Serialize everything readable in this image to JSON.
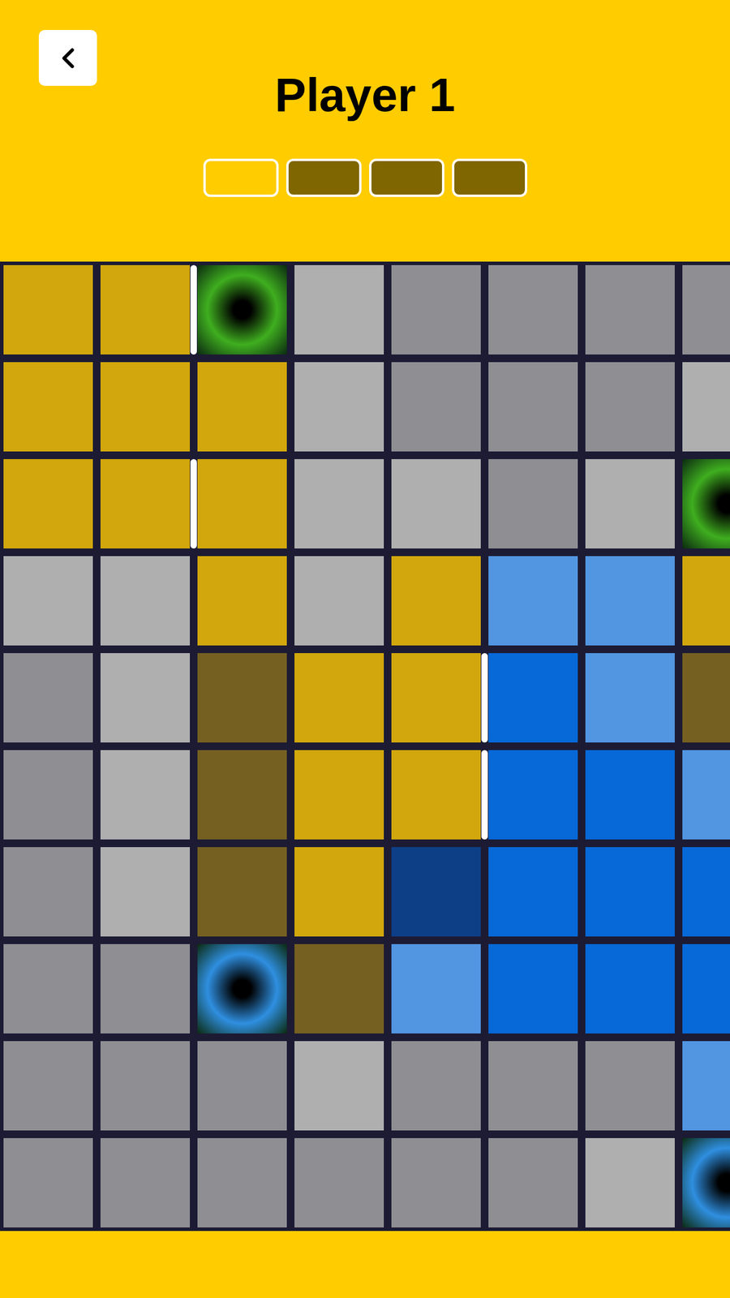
{
  "header": {
    "title": "Player 1"
  },
  "progress": [
    {
      "filled": false
    },
    {
      "filled": true
    },
    {
      "filled": true
    },
    {
      "filled": true
    }
  ],
  "board": {
    "rows": [
      [
        {
          "kind": "tile",
          "color": "#D1A70D",
          "wall_left": false
        },
        {
          "kind": "tile",
          "color": "#D1A70D",
          "wall_left": false
        },
        {
          "kind": "hole",
          "color": "#3FAE1F",
          "wall_left": true
        },
        {
          "kind": "tile",
          "color": "#AFAFB0",
          "wall_left": false
        },
        {
          "kind": "tile",
          "color": "#8F8E93",
          "wall_left": false
        },
        {
          "kind": "tile",
          "color": "#8F8E93",
          "wall_left": false
        },
        {
          "kind": "tile",
          "color": "#8F8E93",
          "wall_left": false
        },
        {
          "kind": "tile",
          "color": "#8F8E93",
          "wall_left": false
        }
      ],
      [
        {
          "kind": "tile",
          "color": "#D1A70D",
          "wall_left": false
        },
        {
          "kind": "tile",
          "color": "#D1A70D",
          "wall_left": false
        },
        {
          "kind": "tile",
          "color": "#D1A70D",
          "wall_left": false
        },
        {
          "kind": "tile",
          "color": "#AFAFB0",
          "wall_left": false
        },
        {
          "kind": "tile",
          "color": "#8F8E93",
          "wall_left": false
        },
        {
          "kind": "tile",
          "color": "#8F8E93",
          "wall_left": false
        },
        {
          "kind": "tile",
          "color": "#8F8E93",
          "wall_left": false
        },
        {
          "kind": "tile",
          "color": "#AFAFB0",
          "wall_left": false
        }
      ],
      [
        {
          "kind": "tile",
          "color": "#D1A70D",
          "wall_left": false
        },
        {
          "kind": "tile",
          "color": "#D1A70D",
          "wall_left": false
        },
        {
          "kind": "tile",
          "color": "#D1A70D",
          "wall_left": true
        },
        {
          "kind": "tile",
          "color": "#AFAFB0",
          "wall_left": false
        },
        {
          "kind": "tile",
          "color": "#AFAFB0",
          "wall_left": false
        },
        {
          "kind": "tile",
          "color": "#8F8E93",
          "wall_left": false
        },
        {
          "kind": "tile",
          "color": "#AFAFB0",
          "wall_left": false
        },
        {
          "kind": "hole",
          "color": "#3FAE1F",
          "wall_left": false
        }
      ],
      [
        {
          "kind": "tile",
          "color": "#AFAFB0",
          "wall_left": false
        },
        {
          "kind": "tile",
          "color": "#AFAFB0",
          "wall_left": false
        },
        {
          "kind": "tile",
          "color": "#D1A70D",
          "wall_left": false
        },
        {
          "kind": "tile",
          "color": "#AFAFB0",
          "wall_left": false
        },
        {
          "kind": "tile",
          "color": "#D1A70D",
          "wall_left": false
        },
        {
          "kind": "tile",
          "color": "#5295E1",
          "wall_left": false
        },
        {
          "kind": "tile",
          "color": "#5295E1",
          "wall_left": false
        },
        {
          "kind": "tile",
          "color": "#D1A70D",
          "wall_left": false
        }
      ],
      [
        {
          "kind": "tile",
          "color": "#8F8E93",
          "wall_left": false
        },
        {
          "kind": "tile",
          "color": "#AFAFB0",
          "wall_left": false
        },
        {
          "kind": "tile",
          "color": "#756021",
          "wall_left": false
        },
        {
          "kind": "tile",
          "color": "#D1A70D",
          "wall_left": false
        },
        {
          "kind": "tile",
          "color": "#D1A70D",
          "wall_left": false
        },
        {
          "kind": "tile",
          "color": "#0768D8",
          "wall_left": true
        },
        {
          "kind": "tile",
          "color": "#5295E1",
          "wall_left": false
        },
        {
          "kind": "tile",
          "color": "#756021",
          "wall_left": false
        }
      ],
      [
        {
          "kind": "tile",
          "color": "#8F8E93",
          "wall_left": false
        },
        {
          "kind": "tile",
          "color": "#AFAFB0",
          "wall_left": false
        },
        {
          "kind": "tile",
          "color": "#756021",
          "wall_left": false
        },
        {
          "kind": "tile",
          "color": "#D1A70D",
          "wall_left": false
        },
        {
          "kind": "tile",
          "color": "#D1A70D",
          "wall_left": false
        },
        {
          "kind": "tile",
          "color": "#0768D8",
          "wall_left": true
        },
        {
          "kind": "tile",
          "color": "#0768D8",
          "wall_left": false
        },
        {
          "kind": "tile",
          "color": "#5295E1",
          "wall_left": false
        }
      ],
      [
        {
          "kind": "tile",
          "color": "#8F8E93",
          "wall_left": false
        },
        {
          "kind": "tile",
          "color": "#AFAFB0",
          "wall_left": false
        },
        {
          "kind": "tile",
          "color": "#756021",
          "wall_left": false
        },
        {
          "kind": "tile",
          "color": "#D1A70D",
          "wall_left": false
        },
        {
          "kind": "tile",
          "color": "#0D3F87",
          "wall_left": false
        },
        {
          "kind": "tile",
          "color": "#0768D8",
          "wall_left": false
        },
        {
          "kind": "tile",
          "color": "#0768D8",
          "wall_left": false
        },
        {
          "kind": "tile",
          "color": "#0768D8",
          "wall_left": false
        }
      ],
      [
        {
          "kind": "tile",
          "color": "#8F8E93",
          "wall_left": false
        },
        {
          "kind": "tile",
          "color": "#8F8E93",
          "wall_left": false
        },
        {
          "kind": "hole",
          "color": "#2F8FE0",
          "wall_left": false
        },
        {
          "kind": "tile",
          "color": "#756021",
          "wall_left": false
        },
        {
          "kind": "tile",
          "color": "#5295E1",
          "wall_left": false
        },
        {
          "kind": "tile",
          "color": "#0768D8",
          "wall_left": false
        },
        {
          "kind": "tile",
          "color": "#0768D8",
          "wall_left": false
        },
        {
          "kind": "tile",
          "color": "#0768D8",
          "wall_left": false
        }
      ],
      [
        {
          "kind": "tile",
          "color": "#8F8E93",
          "wall_left": false
        },
        {
          "kind": "tile",
          "color": "#8F8E93",
          "wall_left": false
        },
        {
          "kind": "tile",
          "color": "#8F8E93",
          "wall_left": false
        },
        {
          "kind": "tile",
          "color": "#AFAFB0",
          "wall_left": false
        },
        {
          "kind": "tile",
          "color": "#8F8E93",
          "wall_left": false
        },
        {
          "kind": "tile",
          "color": "#8F8E93",
          "wall_left": false
        },
        {
          "kind": "tile",
          "color": "#8F8E93",
          "wall_left": false
        },
        {
          "kind": "tile",
          "color": "#5295E1",
          "wall_left": false
        }
      ],
      [
        {
          "kind": "tile",
          "color": "#8F8E93",
          "wall_left": false
        },
        {
          "kind": "tile",
          "color": "#8F8E93",
          "wall_left": false
        },
        {
          "kind": "tile",
          "color": "#8F8E93",
          "wall_left": false
        },
        {
          "kind": "tile",
          "color": "#8F8E93",
          "wall_left": false
        },
        {
          "kind": "tile",
          "color": "#8F8E93",
          "wall_left": false
        },
        {
          "kind": "tile",
          "color": "#8F8E93",
          "wall_left": false
        },
        {
          "kind": "tile",
          "color": "#AFAFB0",
          "wall_left": false
        },
        {
          "kind": "hole",
          "color": "#2F8FE0",
          "wall_left": false
        }
      ]
    ]
  }
}
